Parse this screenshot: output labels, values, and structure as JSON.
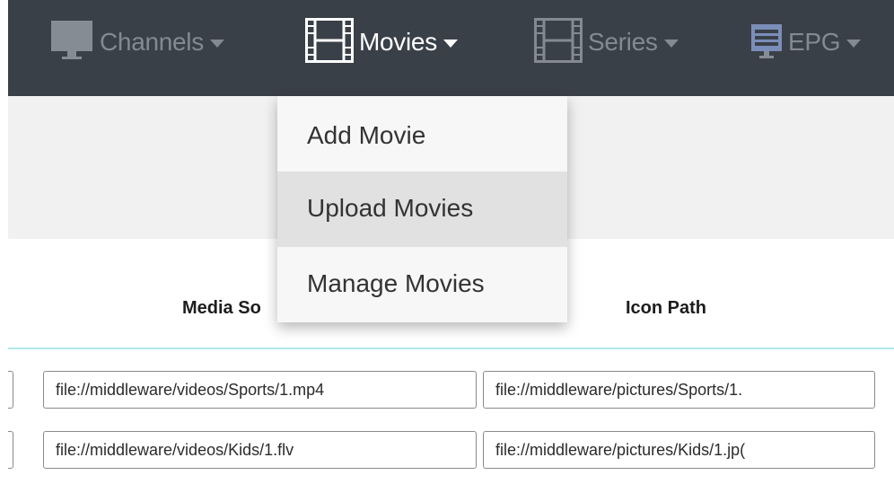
{
  "navbar": {
    "items": [
      {
        "label": "Channels",
        "icon": "monitor-icon",
        "active": false
      },
      {
        "label": "Movies",
        "icon": "film-icon",
        "active": true
      },
      {
        "label": "Series",
        "icon": "film-icon",
        "active": false
      },
      {
        "label": "EPG",
        "icon": "tv-guide-icon",
        "active": false
      }
    ]
  },
  "movies_menu": {
    "items": [
      {
        "label": "Add Movie"
      },
      {
        "label": "Upload Movies",
        "highlighted": true
      },
      {
        "label": "Manage Movies"
      }
    ]
  },
  "table": {
    "headers": {
      "media_source": "Media So",
      "icon_path": "Icon Path"
    },
    "rows": [
      {
        "first": "",
        "media_source": "file://middleware/videos/Sports/1.mp4",
        "icon_path": "file://middleware/pictures/Sports/1."
      },
      {
        "first": "",
        "media_source": "file://middleware/videos/Kids/1.flv",
        "icon_path": "file://middleware/pictures/Kids/1.jp("
      }
    ]
  },
  "colors": {
    "navbar_bg": "#3a4047",
    "nav_inactive": "#838a92",
    "nav_active": "#ffffff",
    "banner_bg": "#f1f1f1",
    "menu_highlight": "#e1e1e1",
    "header_rule": "#aeeaea"
  }
}
